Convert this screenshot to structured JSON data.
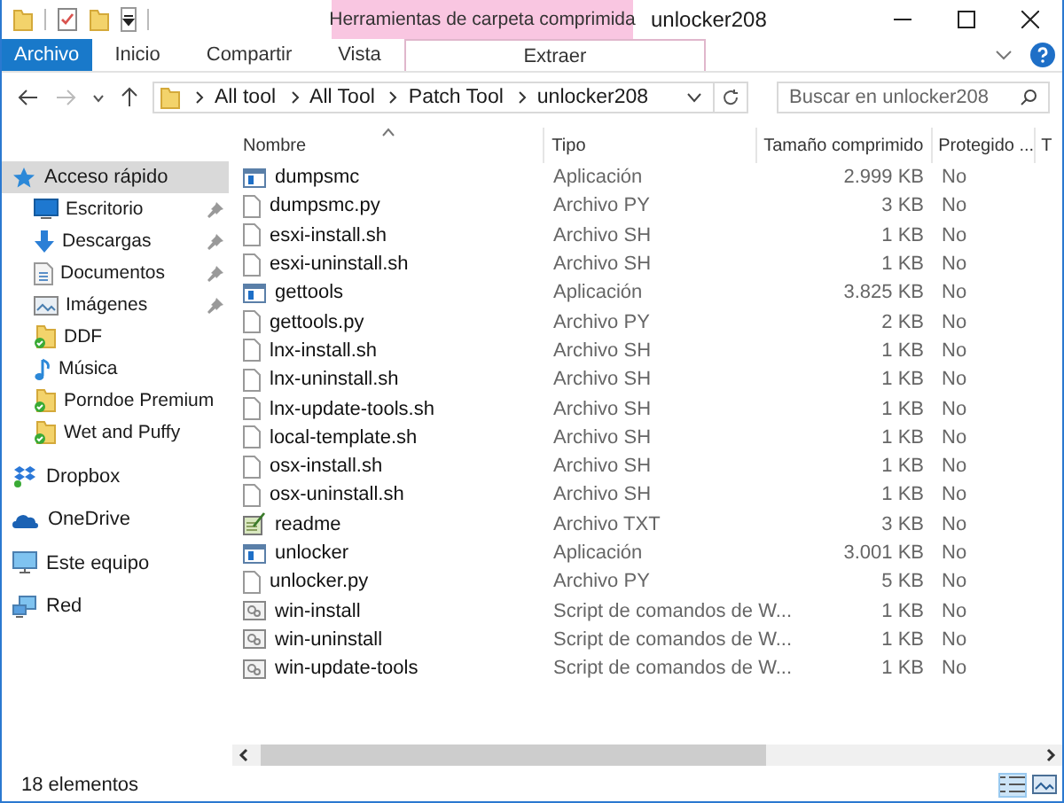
{
  "title_bar": {
    "contextual_group": "Herramientas de carpeta comprimida",
    "title": "unlocker208"
  },
  "ribbon_tabs": [
    {
      "label": "Archivo",
      "kind": "file"
    },
    {
      "label": "Inicio",
      "kind": "normal"
    },
    {
      "label": "Compartir",
      "kind": "normal"
    },
    {
      "label": "Vista",
      "kind": "normal"
    },
    {
      "label": "Extraer",
      "kind": "contextual"
    }
  ],
  "address_bar": {
    "path": [
      "All tool",
      "All Tool",
      "Patch Tool",
      "unlocker208"
    ]
  },
  "search": {
    "placeholder": "Buscar en unlocker208"
  },
  "sidebar": {
    "items": [
      {
        "label": "Acceso rápido",
        "kind": "star",
        "selected": true,
        "children": [
          {
            "label": "Escritorio",
            "kind": "desktop",
            "pinned": true,
            "selected": false
          },
          {
            "label": "Descargas",
            "kind": "download",
            "pinned": true,
            "selected": false
          },
          {
            "label": "Documentos",
            "kind": "document",
            "pinned": true,
            "selected": false
          },
          {
            "label": "Imágenes",
            "kind": "images",
            "pinned": true,
            "selected": false
          },
          {
            "label": "DDF",
            "kind": "synced-folder",
            "pinned": false,
            "selected": false
          },
          {
            "label": "Música",
            "kind": "music",
            "pinned": false,
            "selected": false
          },
          {
            "label": "Porndoe Premium",
            "kind": "synced-folder",
            "pinned": false,
            "selected": false
          },
          {
            "label": "Wet and Puffy",
            "kind": "synced-folder",
            "pinned": false,
            "selected": false
          }
        ]
      },
      {
        "label": "Dropbox",
        "kind": "dropbox",
        "selected": false
      },
      {
        "label": "OneDrive",
        "kind": "onedrive",
        "selected": false
      },
      {
        "label": "Este equipo",
        "kind": "computer",
        "selected": false
      },
      {
        "label": "Red",
        "kind": "network",
        "selected": false
      }
    ]
  },
  "table": {
    "columns": [
      {
        "label": "Nombre",
        "sorted": true
      },
      {
        "label": "Tipo",
        "sorted": false
      },
      {
        "label": "Tamaño comprimido",
        "sorted": false
      },
      {
        "label": "Protegido ...",
        "sorted": false
      },
      {
        "label": "T",
        "sorted": false
      }
    ],
    "rows": [
      {
        "name": "dumpsmc",
        "type": "Aplicación",
        "size": "2.999 KB",
        "protected": "No",
        "kind": "app"
      },
      {
        "name": "dumpsmc.py",
        "type": "Archivo PY",
        "size": "3 KB",
        "protected": "No",
        "kind": "file"
      },
      {
        "name": "esxi-install.sh",
        "type": "Archivo SH",
        "size": "1 KB",
        "protected": "No",
        "kind": "file"
      },
      {
        "name": "esxi-uninstall.sh",
        "type": "Archivo SH",
        "size": "1 KB",
        "protected": "No",
        "kind": "file"
      },
      {
        "name": "gettools",
        "type": "Aplicación",
        "size": "3.825 KB",
        "protected": "No",
        "kind": "app"
      },
      {
        "name": "gettools.py",
        "type": "Archivo PY",
        "size": "2 KB",
        "protected": "No",
        "kind": "file"
      },
      {
        "name": "lnx-install.sh",
        "type": "Archivo SH",
        "size": "1 KB",
        "protected": "No",
        "kind": "file"
      },
      {
        "name": "lnx-uninstall.sh",
        "type": "Archivo SH",
        "size": "1 KB",
        "protected": "No",
        "kind": "file"
      },
      {
        "name": "lnx-update-tools.sh",
        "type": "Archivo SH",
        "size": "1 KB",
        "protected": "No",
        "kind": "file"
      },
      {
        "name": "local-template.sh",
        "type": "Archivo SH",
        "size": "1 KB",
        "protected": "No",
        "kind": "file"
      },
      {
        "name": "osx-install.sh",
        "type": "Archivo SH",
        "size": "1 KB",
        "protected": "No",
        "kind": "file"
      },
      {
        "name": "osx-uninstall.sh",
        "type": "Archivo SH",
        "size": "1 KB",
        "protected": "No",
        "kind": "file"
      },
      {
        "name": "readme",
        "type": "Archivo TXT",
        "size": "3 KB",
        "protected": "No",
        "kind": "text"
      },
      {
        "name": "unlocker",
        "type": "Aplicación",
        "size": "3.001 KB",
        "protected": "No",
        "kind": "app"
      },
      {
        "name": "unlocker.py",
        "type": "Archivo PY",
        "size": "5 KB",
        "protected": "No",
        "kind": "file"
      },
      {
        "name": "win-install",
        "type": "Script de comandos de W...",
        "size": "1 KB",
        "protected": "No",
        "kind": "script"
      },
      {
        "name": "win-uninstall",
        "type": "Script de comandos de W...",
        "size": "1 KB",
        "protected": "No",
        "kind": "script"
      },
      {
        "name": "win-update-tools",
        "type": "Script de comandos de W...",
        "size": "1 KB",
        "protected": "No",
        "kind": "script"
      }
    ]
  },
  "status_bar": {
    "count": "18 elementos"
  }
}
